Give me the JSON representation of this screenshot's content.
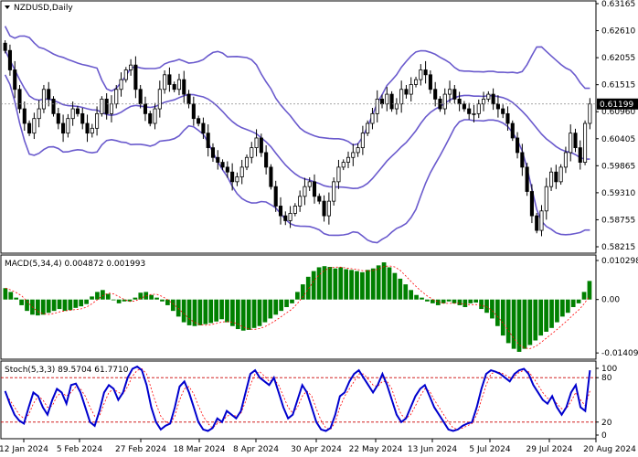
{
  "window": {
    "symbol_title": "NZDUSD,Daily",
    "price_tag": "0.61199"
  },
  "colors": {
    "background": "#ffffff",
    "candles": "#000000",
    "bollinger": "#6a5acd",
    "macd_hist": "#008000",
    "macd_signal": "#ff0000",
    "stoch_main": "#0000cd",
    "stoch_signal": "#ff0000",
    "stoch_levels": "#cc0000",
    "grid": "#000000"
  },
  "chart_data": [
    {
      "type": "candlestick",
      "name": "price-panel",
      "title": "NZDUSD,Daily",
      "y_ticks": [
        "0.63165",
        "0.62610",
        "0.62055",
        "0.61515",
        "0.60960",
        "0.60405",
        "0.59865",
        "0.59310",
        "0.58755",
        "0.58215"
      ],
      "ylim": [
        0.5815,
        0.633
      ],
      "current_price": 0.61199,
      "close": [
        0.623,
        0.619,
        0.615,
        0.611,
        0.608,
        0.606,
        0.609,
        0.611,
        0.615,
        0.613,
        0.61,
        0.608,
        0.606,
        0.609,
        0.611,
        0.61,
        0.608,
        0.606,
        0.607,
        0.61,
        0.613,
        0.61,
        0.612,
        0.615,
        0.617,
        0.619,
        0.62,
        0.615,
        0.612,
        0.61,
        0.608,
        0.611,
        0.615,
        0.618,
        0.616,
        0.615,
        0.617,
        0.614,
        0.612,
        0.609,
        0.608,
        0.606,
        0.603,
        0.601,
        0.6,
        0.599,
        0.598,
        0.596,
        0.597,
        0.599,
        0.601,
        0.603,
        0.605,
        0.602,
        0.599,
        0.595,
        0.591,
        0.589,
        0.588,
        0.5895,
        0.591,
        0.593,
        0.595,
        0.596,
        0.593,
        0.592,
        0.589,
        0.592,
        0.596,
        0.599,
        0.6,
        0.601,
        0.602,
        0.603,
        0.606,
        0.608,
        0.61,
        0.613,
        0.612,
        0.614,
        0.611,
        0.612,
        0.615,
        0.614,
        0.616,
        0.617,
        0.619,
        0.618,
        0.615,
        0.613,
        0.611,
        0.614,
        0.615,
        0.613,
        0.612,
        0.611,
        0.61,
        0.61,
        0.612,
        0.613,
        0.614,
        0.612,
        0.611,
        0.61,
        0.608,
        0.605,
        0.602,
        0.599,
        0.594,
        0.589,
        0.586,
        0.59,
        0.595,
        0.598,
        0.596,
        0.599,
        0.602,
        0.606,
        0.603,
        0.6,
        0.608,
        0.612
      ],
      "indicator": "Bollinger Bands",
      "x_ticks": [
        "12 Jan 2024",
        "5 Feb 2024",
        "27 Feb 2024",
        "18 Mar 2024",
        "8 Apr 2024",
        "30 Apr 2024",
        "22 May 2024",
        "13 Jun 2024",
        "5 Jul 2024",
        "29 Jul 2024",
        "20 Aug 2024"
      ]
    },
    {
      "type": "bar",
      "name": "macd-panel",
      "title": "MACD(5,34,4) 0.004872 0.001993",
      "y_ticks": [
        "0.010298",
        "0.00",
        "-0.014091"
      ],
      "ylim": [
        -0.0155,
        0.0115
      ],
      "series": [
        {
          "name": "MACD",
          "values": [
            0.003,
            0.002,
            0.0005,
            -0.0015,
            -0.003,
            -0.004,
            -0.0042,
            -0.004,
            -0.0035,
            -0.003,
            -0.0025,
            -0.003,
            -0.0028,
            -0.0022,
            -0.0018,
            -0.0012,
            0.0008,
            0.002,
            0.0025,
            0.0015,
            0.0,
            -0.001,
            -0.0005,
            -0.0005,
            0.0005,
            0.0018,
            0.002,
            0.0012,
            0.0005,
            -0.0005,
            -0.0015,
            -0.003,
            -0.0045,
            -0.006,
            -0.0068,
            -0.007,
            -0.0068,
            -0.0065,
            -0.0062,
            -0.0058,
            -0.0052,
            -0.006,
            -0.007,
            -0.0078,
            -0.0082,
            -0.008,
            -0.0075,
            -0.007,
            -0.006,
            -0.005,
            -0.004,
            -0.003,
            -0.002,
            -0.001,
            0.002,
            0.004,
            0.006,
            0.0075,
            0.0085,
            0.0088,
            0.0086,
            0.0082,
            0.0085,
            0.008,
            0.0078,
            0.0075,
            0.0072,
            0.0078,
            0.0082,
            0.009,
            0.0098,
            0.0085,
            0.007,
            0.0055,
            0.004,
            0.0025,
            0.0012,
            0.0005,
            -0.0005,
            -0.001,
            -0.0015,
            -0.001,
            -0.0005,
            -0.001,
            -0.0015,
            -0.002,
            -0.001,
            -0.0008,
            -0.0025,
            -0.0035,
            -0.005,
            -0.007,
            -0.0095,
            -0.0115,
            -0.013,
            -0.0138,
            -0.013,
            -0.012,
            -0.0108,
            -0.0095,
            -0.0085,
            -0.0075,
            -0.006,
            -0.0045,
            -0.0035,
            -0.002,
            -0.001,
            0.002,
            0.0049
          ]
        }
      ]
    },
    {
      "type": "line",
      "name": "stoch-panel",
      "title": "Stoch(5,3,3) 89.5704 61.7710",
      "y_ticks": [
        "100",
        "80",
        "20",
        "0"
      ],
      "ylim": [
        0,
        100
      ],
      "levels": [
        80,
        20
      ],
      "series": [
        {
          "name": "main",
          "values": [
            62,
            45,
            30,
            22,
            18,
            40,
            60,
            55,
            40,
            30,
            50,
            65,
            60,
            45,
            70,
            72,
            60,
            40,
            20,
            15,
            35,
            60,
            70,
            65,
            50,
            60,
            80,
            92,
            95,
            90,
            70,
            40,
            20,
            10,
            15,
            18,
            40,
            68,
            75,
            60,
            40,
            20,
            10,
            8,
            12,
            25,
            20,
            35,
            30,
            25,
            35,
            60,
            85,
            90,
            80,
            75,
            70,
            80,
            60,
            40,
            25,
            30,
            50,
            70,
            60,
            40,
            20,
            10,
            8,
            12,
            30,
            55,
            60,
            75,
            85,
            90,
            80,
            70,
            60,
            70,
            85,
            70,
            50,
            30,
            20,
            25,
            40,
            55,
            65,
            70,
            55,
            40,
            30,
            20,
            10,
            8,
            10,
            15,
            18,
            20,
            40,
            65,
            85,
            90,
            88,
            85,
            80,
            75,
            85,
            90,
            92,
            85,
            70,
            60,
            50,
            45,
            55,
            40,
            30,
            40,
            60,
            70,
            40,
            35,
            90
          ]
        },
        {
          "name": "signal",
          "values": [
            60,
            50,
            40,
            30,
            25,
            30,
            45,
            55,
            50,
            40,
            42,
            55,
            60,
            55,
            60,
            68,
            65,
            55,
            40,
            28,
            28,
            45,
            60,
            65,
            60,
            58,
            68,
            82,
            90,
            92,
            85,
            65,
            45,
            28,
            20,
            18,
            28,
            50,
            65,
            68,
            58,
            42,
            28,
            18,
            12,
            18,
            20,
            28,
            30,
            28,
            32,
            48,
            70,
            85,
            88,
            82,
            75,
            78,
            70,
            55,
            40,
            32,
            40,
            55,
            62,
            55,
            38,
            22,
            12,
            10,
            20,
            40,
            55,
            65,
            75,
            85,
            85,
            78,
            70,
            68,
            75,
            75,
            65,
            45,
            30,
            25,
            30,
            42,
            55,
            65,
            62,
            50,
            40,
            30,
            20,
            12,
            10,
            12,
            15,
            18,
            30,
            50,
            70,
            85,
            88,
            87,
            84,
            80,
            82,
            87,
            90,
            88,
            80,
            70,
            60,
            52,
            52,
            45,
            38,
            38,
            48,
            60,
            50,
            42,
            62
          ]
        }
      ]
    }
  ]
}
